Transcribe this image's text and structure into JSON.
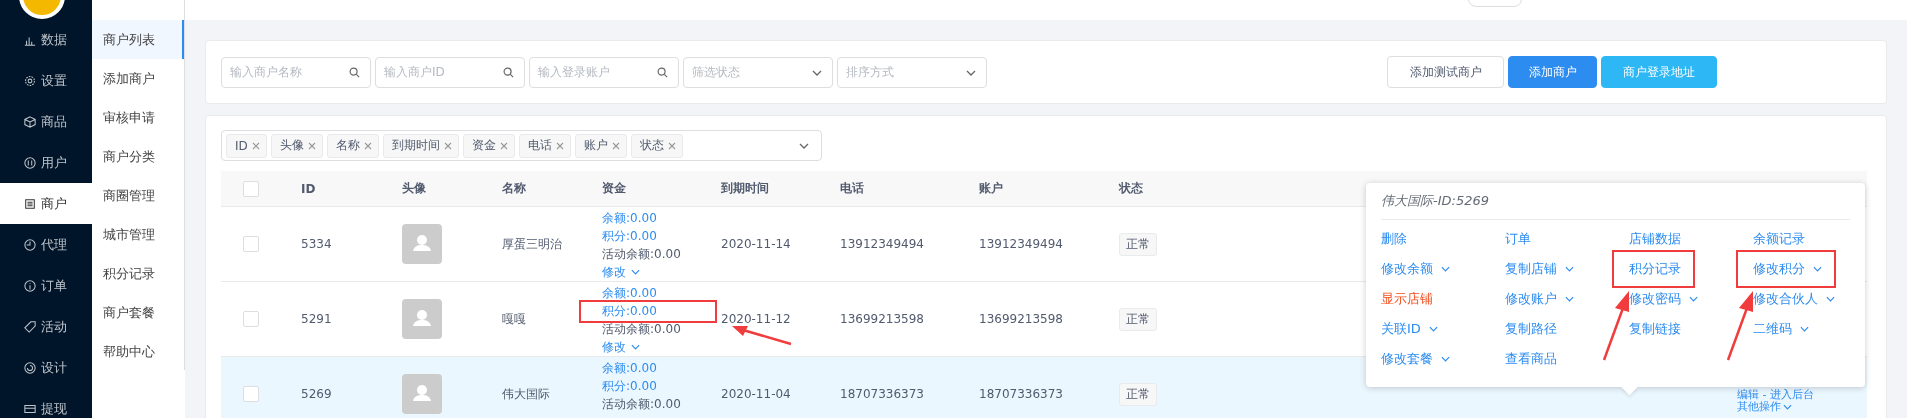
{
  "sidebar": {
    "items": [
      {
        "label": "数据",
        "selected": false
      },
      {
        "label": "设置",
        "selected": false
      },
      {
        "label": "商品",
        "selected": false
      },
      {
        "label": "用户",
        "selected": false
      },
      {
        "label": "商户",
        "selected": true
      },
      {
        "label": "代理",
        "selected": false
      },
      {
        "label": "订单",
        "selected": false
      },
      {
        "label": "活动",
        "selected": false
      },
      {
        "label": "设计",
        "selected": false
      },
      {
        "label": "提现",
        "selected": false
      }
    ]
  },
  "submenu": {
    "items": [
      {
        "label": "商户列表",
        "selected": true
      },
      {
        "label": "添加商户",
        "selected": false
      },
      {
        "label": "审核申请",
        "selected": false
      },
      {
        "label": "商户分类",
        "selected": false
      },
      {
        "label": "商圈管理",
        "selected": false
      },
      {
        "label": "城市管理",
        "selected": false
      },
      {
        "label": "积分记录",
        "selected": false
      },
      {
        "label": "商户套餐",
        "selected": false
      },
      {
        "label": "帮助中心",
        "selected": false
      }
    ]
  },
  "filters": {
    "fields": [
      {
        "kind": "search",
        "placeholder": "输入商户名称"
      },
      {
        "kind": "search",
        "placeholder": "输入商户ID"
      },
      {
        "kind": "search",
        "placeholder": "输入登录账户"
      },
      {
        "kind": "select",
        "placeholder": "筛选状态"
      },
      {
        "kind": "select",
        "placeholder": "排序方式"
      }
    ],
    "buttons": [
      {
        "label": "添加测试商户",
        "kind": "default"
      },
      {
        "label": "添加商户",
        "kind": "primary"
      },
      {
        "label": "商户登录地址",
        "kind": "info"
      }
    ]
  },
  "column_picker": {
    "tags": [
      "ID",
      "头像",
      "名称",
      "到期时间",
      "资金",
      "电话",
      "账户",
      "状态"
    ]
  },
  "table": {
    "columns": [
      "ID",
      "头像",
      "名称",
      "资金",
      "到期时间",
      "电话",
      "账户",
      "状态"
    ],
    "header_checked": false,
    "rows": [
      {
        "checked": false,
        "selected": false,
        "id": "5334",
        "name": "厚蛋三明治",
        "funds": [
          {
            "text": "余额:0.00",
            "kind": "link",
            "marked": false
          },
          {
            "text": "积分:0.00",
            "kind": "link",
            "marked": false
          },
          {
            "text": "活动余额:0.00",
            "kind": "plain",
            "marked": false
          }
        ],
        "edit": "修改",
        "expiry": "2020-11-14",
        "phone": "13912349494",
        "account": "13912349494",
        "status": "正常",
        "actions": []
      },
      {
        "checked": false,
        "selected": false,
        "id": "5291",
        "name": "嘎嘎",
        "funds": [
          {
            "text": "余额:0.00",
            "kind": "link",
            "marked": false
          },
          {
            "text": "积分:0.00",
            "kind": "link",
            "marked": true
          },
          {
            "text": "活动余额:0.00",
            "kind": "plain",
            "marked": false
          }
        ],
        "edit": "修改",
        "expiry": "2020-11-12",
        "phone": "13699213598",
        "account": "13699213598",
        "status": "正常",
        "actions": []
      },
      {
        "checked": false,
        "selected": true,
        "id": "5269",
        "name": "伟大国际",
        "funds": [
          {
            "text": "余额:0.00",
            "kind": "link",
            "marked": false
          },
          {
            "text": "积分:0.00",
            "kind": "link",
            "marked": false
          },
          {
            "text": "活动余额:0.00",
            "kind": "plain",
            "marked": false
          }
        ],
        "expiry": "2020-11-04",
        "phone": "18707336373",
        "account": "18707336373",
        "status": "正常",
        "actions": [
          {
            "label": "编辑 - 进入后台",
            "has_menu": false
          },
          {
            "label": "其他操作",
            "has_menu": true
          }
        ]
      }
    ]
  },
  "popup": {
    "title": "伟大国际-ID:5269",
    "columns": [
      [
        {
          "label": "删除",
          "kind": "link",
          "has_menu": false,
          "marked": false
        },
        {
          "label": "修改余额",
          "kind": "link",
          "has_menu": true,
          "marked": false
        },
        {
          "label": "显示店铺",
          "kind": "danger",
          "has_menu": false,
          "marked": false
        },
        {
          "label": "关联ID",
          "kind": "link",
          "has_menu": true,
          "marked": false
        },
        {
          "label": "修改套餐",
          "kind": "link",
          "has_menu": true,
          "marked": false
        }
      ],
      [
        {
          "label": "订单",
          "kind": "link",
          "has_menu": false,
          "marked": false
        },
        {
          "label": "复制店铺",
          "kind": "link",
          "has_menu": true,
          "marked": false
        },
        {
          "label": "修改账户",
          "kind": "link",
          "has_menu": true,
          "marked": false
        },
        {
          "label": "复制路径",
          "kind": "link",
          "has_menu": false,
          "marked": false
        },
        {
          "label": "查看商品",
          "kind": "link",
          "has_menu": false,
          "marked": false
        }
      ],
      [
        {
          "label": "店铺数据",
          "kind": "link",
          "has_menu": false,
          "marked": false
        },
        {
          "label": "积分记录",
          "kind": "link",
          "has_menu": false,
          "marked": true
        },
        {
          "label": "修改密码",
          "kind": "link",
          "has_menu": true,
          "marked": false
        },
        {
          "label": "复制链接",
          "kind": "link",
          "has_menu": false,
          "marked": false
        }
      ],
      [
        {
          "label": "余额记录",
          "kind": "link",
          "has_menu": false,
          "marked": false
        },
        {
          "label": "修改积分",
          "kind": "link",
          "has_menu": true,
          "marked": true
        },
        {
          "label": "修改合伙人",
          "kind": "link",
          "has_menu": true,
          "marked": false
        },
        {
          "label": "二维码",
          "kind": "link",
          "has_menu": true,
          "marked": false
        }
      ]
    ]
  }
}
